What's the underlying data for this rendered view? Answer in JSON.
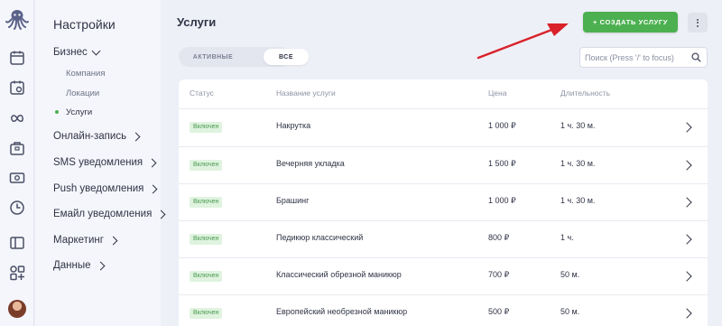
{
  "settings": {
    "title": "Настройки",
    "business": "Бизнес",
    "business_items": [
      "Компания",
      "Локации",
      "Услуги"
    ],
    "sections": [
      "Онлайн-запись",
      "SMS уведомления",
      "Push уведомления",
      "Емайл уведомления",
      "Маркетинг",
      "Данные"
    ]
  },
  "rail_icons": [
    "octopus-logo",
    "calendar-icon",
    "calendar-gear-icon",
    "infinity-icon",
    "briefcase-icon",
    "cash-icon",
    "clock-icon",
    "page-icon",
    "apps-icon",
    "avatar"
  ],
  "page": {
    "title": "Услуги",
    "create_button": "+ СОЗДАТЬ УСЛУГУ",
    "tabs": [
      "АКТИВНЫЕ",
      "ВСЕ"
    ],
    "selected_tab": "ВСЕ",
    "search_placeholder": "Поиск (Press '/' to focus)"
  },
  "table": {
    "headers": [
      "Статус",
      "Название услуги",
      "Цена",
      "Длительность"
    ],
    "rows": [
      {
        "status": "Включен",
        "name": "Накрутка",
        "price": "1 000 ₽",
        "duration": "1 ч. 30 м."
      },
      {
        "status": "Включен",
        "name": "Вечерняя укладка",
        "price": "1 500 ₽",
        "duration": "1 ч. 30 м."
      },
      {
        "status": "Включен",
        "name": "Брашинг",
        "price": "1 000 ₽",
        "duration": "1 ч. 30 м."
      },
      {
        "status": "Включен",
        "name": "Педикюр классический",
        "price": "800 ₽",
        "duration": "1 ч."
      },
      {
        "status": "Включен",
        "name": "Классический обрезной маникюр",
        "price": "700 ₽",
        "duration": "50 м."
      },
      {
        "status": "Включен",
        "name": "Европейский необрезной маникюр",
        "price": "500 ₽",
        "duration": "50 м."
      }
    ]
  },
  "colors": {
    "accent": "#4cb050",
    "annotation_arrow": "#d9222a",
    "badge_bg": "#dff3df"
  }
}
